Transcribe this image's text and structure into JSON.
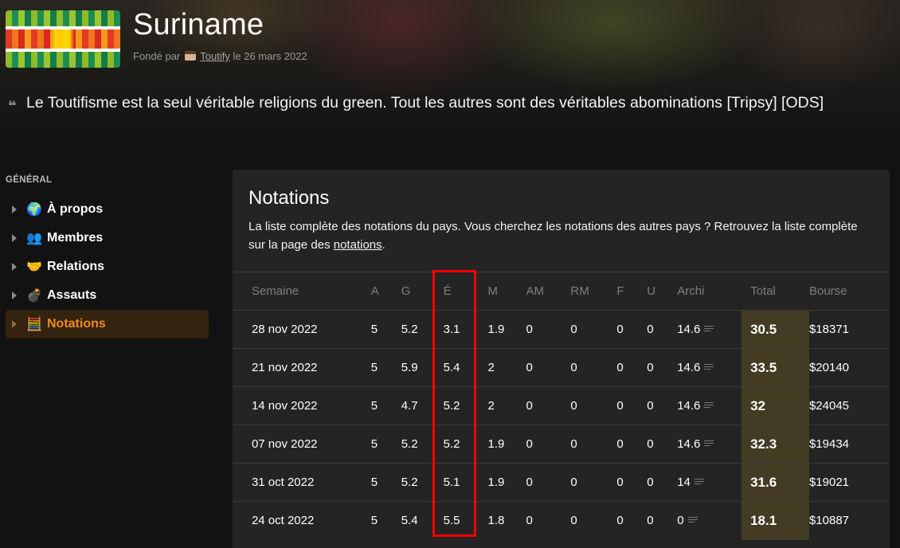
{
  "header": {
    "title": "Suriname",
    "founded_prefix": "Fondé par",
    "founder": "Toutify",
    "founded_suffix": "le 26 mars 2022",
    "quote": "Le Toutifisme est la seul véritable religions du green. Tout les autres sont des véritables abominations [Tripsy] [ODS]"
  },
  "sidebar": {
    "section_title": "GÉNÉRAL",
    "items": [
      {
        "label": "À propos",
        "icon": "globe-icon",
        "glyph": "🌍",
        "active": false
      },
      {
        "label": "Membres",
        "icon": "people-icon",
        "glyph": "👥",
        "active": false
      },
      {
        "label": "Relations",
        "icon": "handshake-icon",
        "glyph": "🤝",
        "active": false
      },
      {
        "label": "Assauts",
        "icon": "bomb-icon",
        "glyph": "💣",
        "active": false
      },
      {
        "label": "Notations",
        "icon": "abacus-icon",
        "glyph": "🧮",
        "active": true
      }
    ]
  },
  "main": {
    "title": "Notations",
    "description_before": "La liste complète des notations du pays. Vous cherchez les notations des autres pays ? Retrouvez la liste complète sur la page des ",
    "description_link": "notations",
    "description_after": ".",
    "table": {
      "headers": [
        "Semaine",
        "A",
        "G",
        "É",
        "M",
        "AM",
        "RM",
        "F",
        "U",
        "Archi",
        "Total",
        "Bourse"
      ],
      "rows": [
        [
          "28 nov 2022",
          "5",
          "5.2",
          "3.1",
          "1.9",
          "0",
          "0",
          "0",
          "0",
          "14.6",
          "30.5",
          "$18371"
        ],
        [
          "21 nov 2022",
          "5",
          "5.9",
          "5.4",
          "2",
          "0",
          "0",
          "0",
          "0",
          "14.6",
          "33.5",
          "$20140"
        ],
        [
          "14 nov 2022",
          "5",
          "4.7",
          "5.2",
          "2",
          "0",
          "0",
          "0",
          "0",
          "14.6",
          "32",
          "$24045"
        ],
        [
          "07 nov 2022",
          "5",
          "5.2",
          "5.2",
          "1.9",
          "0",
          "0",
          "0",
          "0",
          "14.6",
          "32.3",
          "$19434"
        ],
        [
          "31 oct 2022",
          "5",
          "5.2",
          "5.1",
          "1.9",
          "0",
          "0",
          "0",
          "0",
          "14",
          "31.6",
          "$19021"
        ],
        [
          "24 oct 2022",
          "5",
          "5.4",
          "5.5",
          "1.8",
          "0",
          "0",
          "0",
          "0",
          "0",
          "18.1",
          "$10887"
        ]
      ]
    }
  },
  "colors": {
    "accent": "#f08a1c",
    "highlight_box": "#ff0000",
    "total_column_bg": "#433b22",
    "panel_bg": "#242424"
  }
}
